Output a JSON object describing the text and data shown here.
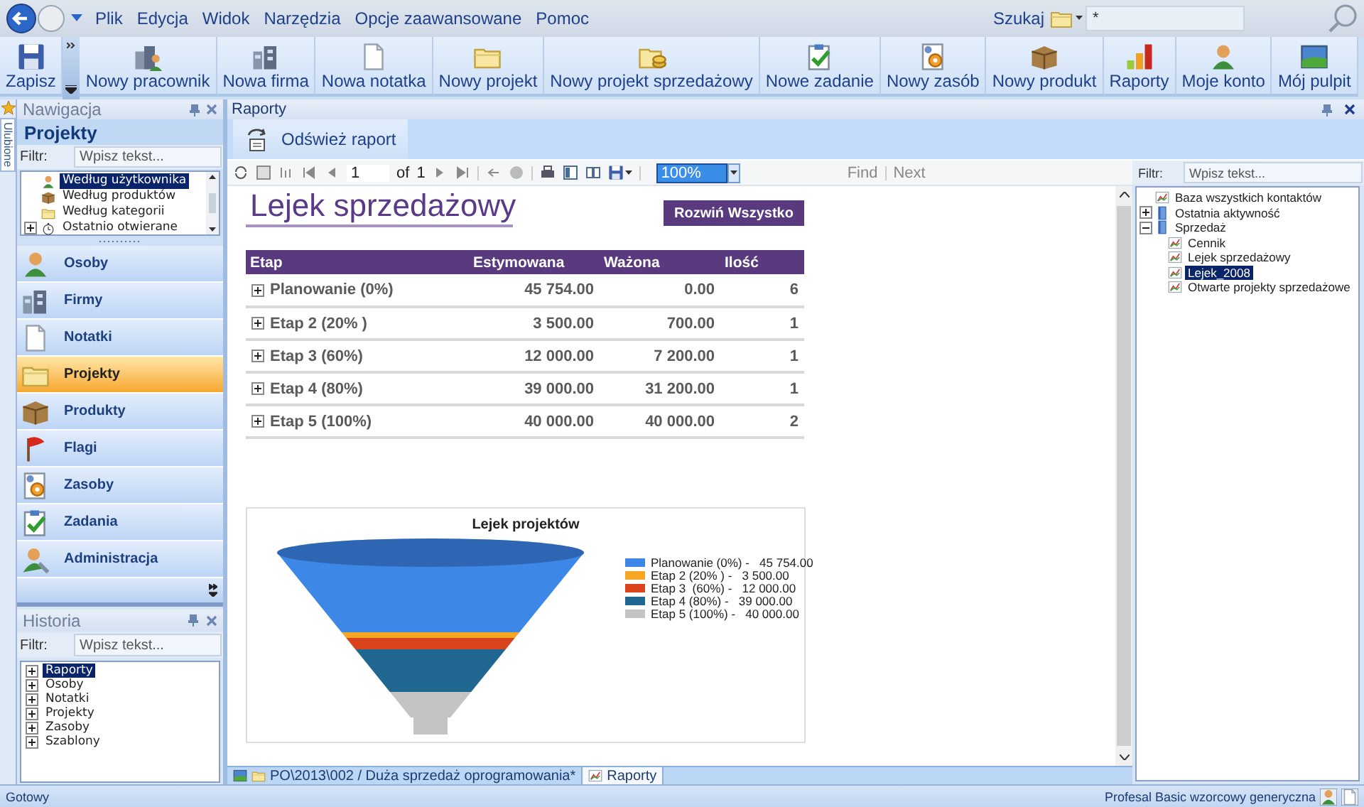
{
  "menu_bar": {
    "items": [
      "Plik",
      "Edycja",
      "Widok",
      "Narzędzia",
      "Opcje zaawansowane",
      "Pomoc"
    ],
    "search_label": "Szukaj",
    "search_value": "*"
  },
  "toolbar": [
    {
      "label": "Zapisz"
    },
    {
      "label": "Nowy pracownik"
    },
    {
      "label": "Nowa firma"
    },
    {
      "label": "Nowa notatka"
    },
    {
      "label": "Nowy projekt"
    },
    {
      "label": "Nowy projekt sprzedażowy"
    },
    {
      "label": "Nowe zadanie"
    },
    {
      "label": "Nowy zasób"
    },
    {
      "label": "Nowy produkt"
    },
    {
      "label": "Raporty"
    },
    {
      "label": "Moje konto"
    },
    {
      "label": "Mój pulpit"
    }
  ],
  "favorites_tab": "Ulubione",
  "navigation": {
    "title": "Nawigacja",
    "section": "Projekty",
    "filter_label": "Filtr:",
    "filter_placeholder": "Wpisz tekst...",
    "tree": [
      {
        "label": "Według użytkownika",
        "selected": true
      },
      {
        "label": "Według produktów",
        "selected": false
      },
      {
        "label": "Według kategorii",
        "selected": false
      },
      {
        "label": "Ostatnio otwierane",
        "selected": false,
        "expanded": false
      }
    ],
    "buttons": [
      {
        "label": "Osoby",
        "selected": false
      },
      {
        "label": "Firmy",
        "selected": false
      },
      {
        "label": "Notatki",
        "selected": false
      },
      {
        "label": "Projekty",
        "selected": true
      },
      {
        "label": "Produkty",
        "selected": false
      },
      {
        "label": "Flagi",
        "selected": false
      },
      {
        "label": "Zasoby",
        "selected": false
      },
      {
        "label": "Zadania",
        "selected": false
      },
      {
        "label": "Administracja",
        "selected": false
      }
    ]
  },
  "history": {
    "title": "Historia",
    "filter_label": "Filtr:",
    "filter_placeholder": "Wpisz tekst...",
    "tree": [
      {
        "label": "Raporty",
        "selected": true,
        "expanded": false
      },
      {
        "label": "Osoby",
        "selected": false,
        "expanded": false
      },
      {
        "label": "Notatki",
        "selected": false,
        "expanded": false
      },
      {
        "label": "Projekty",
        "selected": false,
        "expanded": false
      },
      {
        "label": "Zasoby",
        "selected": false,
        "expanded": false
      },
      {
        "label": "Szablony",
        "selected": false,
        "expanded": false
      }
    ]
  },
  "reports": {
    "title": "Raporty",
    "refresh_button": "Odśwież raport",
    "report_toolbar": {
      "page": "1",
      "of": "of",
      "total": "1",
      "zoom": "100%",
      "find": "Find",
      "next": "Next"
    },
    "report": {
      "title": "Lejek sprzedażowy",
      "expand_button": "Rozwiń Wszystko",
      "columns": [
        "Etap",
        "Estymowana",
        "Ważona",
        "Ilość"
      ],
      "rows": [
        {
          "cells": [
            "Planowanie (0%)",
            "45 754.00",
            "0.00",
            "6"
          ],
          "expanded": false
        },
        {
          "cells": [
            "Etap 2 (20% )",
            "3 500.00",
            "700.00",
            "1"
          ],
          "expanded": false
        },
        {
          "cells": [
            "Etap 3  (60%)",
            "12 000.00",
            "7 200.00",
            "1"
          ],
          "expanded": false
        },
        {
          "cells": [
            "Etap 4 (80%)",
            "39 000.00",
            "31 200.00",
            "1"
          ],
          "expanded": false
        },
        {
          "cells": [
            "Etap 5 (100%)",
            "40 000.00",
            "40 000.00",
            "2"
          ],
          "expanded": false
        }
      ],
      "chart": {
        "title": "Lejek projektów",
        "legend": [
          {
            "label": "Planowanie (0%) -   45 754.00",
            "color": "#3d87e6"
          },
          {
            "label": "Etap 2 (20% ) -   3 500.00",
            "color": "#f5a623"
          },
          {
            "label": "Etap 3  (60%) -   12 000.00",
            "color": "#d9441c"
          },
          {
            "label": "Etap 4 (80%) -   39 000.00",
            "color": "#1f6690"
          },
          {
            "label": "Etap 5 (100%) -   40 000.00",
            "color": "#c4c4c4"
          }
        ]
      }
    },
    "document_tabs": [
      {
        "label": "PO\\2013\\002 / Duża sprzedaż oprogramowania*",
        "selected": false
      },
      {
        "label": "Raporty",
        "selected": true
      }
    ],
    "side_filter_label": "Filtr:",
    "side_filter_placeholder": "Wpisz tekst...",
    "side_tree": [
      {
        "label": "Baza wszystkich kontaktów",
        "kind": "report",
        "selected": false
      },
      {
        "label": "Ostatnia aktywność",
        "kind": "folder",
        "selected": false,
        "expanded": false
      },
      {
        "label": "Sprzedaż",
        "kind": "folder",
        "selected": false,
        "expanded": true,
        "children": [
          {
            "label": "Cennik",
            "kind": "report",
            "selected": false
          },
          {
            "label": "Lejek sprzedażowy",
            "kind": "report",
            "selected": false
          },
          {
            "label": "Lejek_2008",
            "kind": "report",
            "selected": true
          },
          {
            "label": "Otwarte projekty sprzedażowe",
            "kind": "report",
            "selected": false
          }
        ]
      }
    ]
  },
  "status_bar": {
    "left": "Gotowy",
    "right": "Profesal Basic wzorcowy generyczna"
  }
}
